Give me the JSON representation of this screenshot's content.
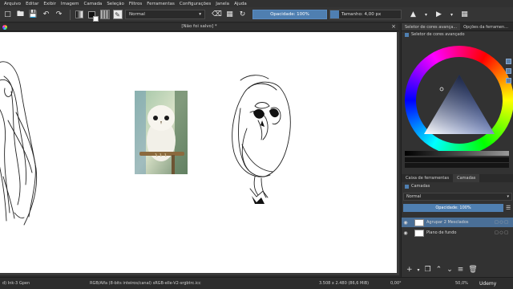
{
  "menu": [
    "Arquivo",
    "Editar",
    "Exibir",
    "Imagem",
    "Camada",
    "Seleção",
    "Filtros",
    "Ferramentas",
    "Configurações",
    "Janela",
    "Ajuda"
  ],
  "toolbar": {
    "blend_mode": "Normal",
    "opacity_label": "Opacidade: 100%",
    "size_label": "Tamanho: 4,00 px",
    "size_fill_fraction": 0.12
  },
  "document": {
    "title": "[Não foi salvo] *"
  },
  "docker": {
    "tabs": [
      "Seletor de cores avança...",
      "Opções da ferramen..."
    ],
    "selector_title": "Seletor de cores avançado",
    "layer_tabs": [
      "Caixa de ferramentas",
      "Camadas"
    ],
    "layers_title": "Camadas",
    "blend_mode": "Normal",
    "opacity_label": "Opacidade: 100%",
    "layers": [
      {
        "name": "Agrupar 2 Mesclados",
        "selected": true
      },
      {
        "name": "Plano de fundo",
        "selected": false
      }
    ]
  },
  "status": {
    "brush": "d) Ink-3 Gpen",
    "color_space": "RGB/Alfa (8-bits inteiros/canal)  sRGB-elle-V2-srgbtrc.icc",
    "dimensions": "3.508 x 2.480 (86,6 MiB)",
    "angle": "0,00°",
    "zoom": "50,0%",
    "watermark": "Udemy"
  }
}
